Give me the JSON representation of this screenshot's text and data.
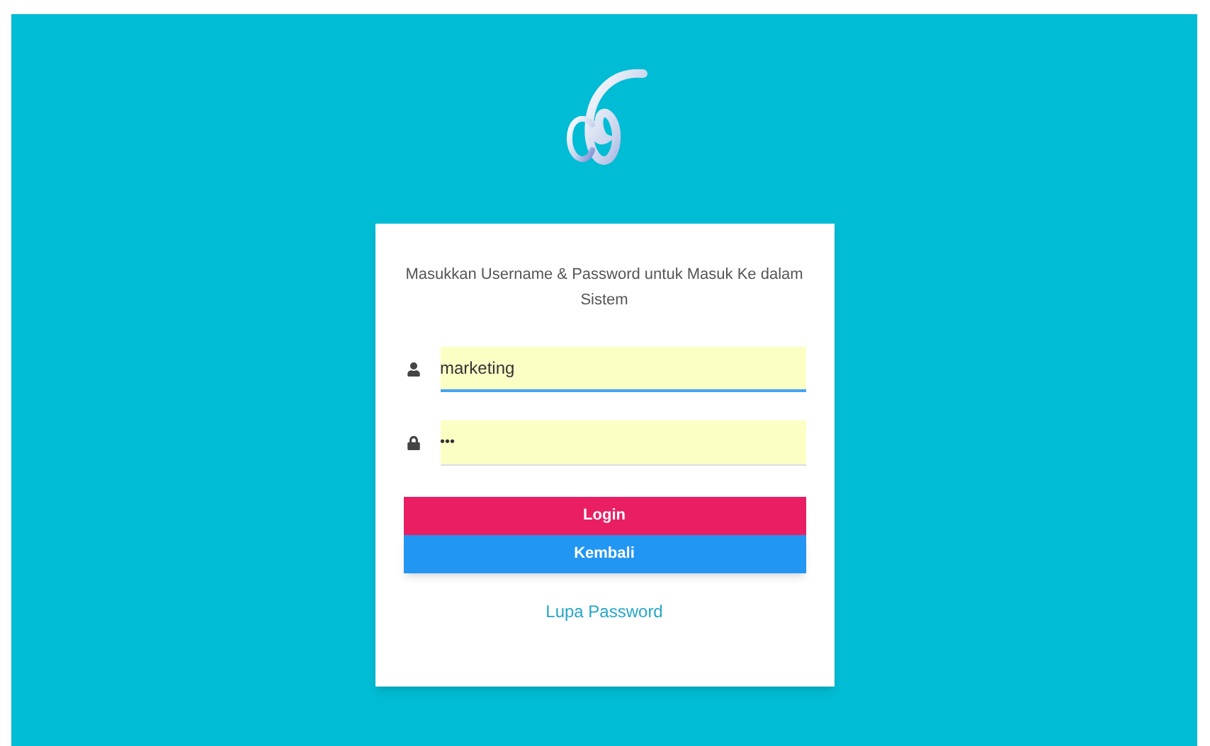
{
  "login": {
    "instruction": "Masukkan Username & Password untuk Masuk Ke dalam Sistem",
    "username": {
      "value": "marketing"
    },
    "password": {
      "value": "•••"
    },
    "buttons": [
      {
        "label": "Login",
        "kind": "primary"
      },
      {
        "label": "Kembali",
        "kind": "secondary"
      }
    ],
    "forgot_link": "Lupa Password"
  }
}
